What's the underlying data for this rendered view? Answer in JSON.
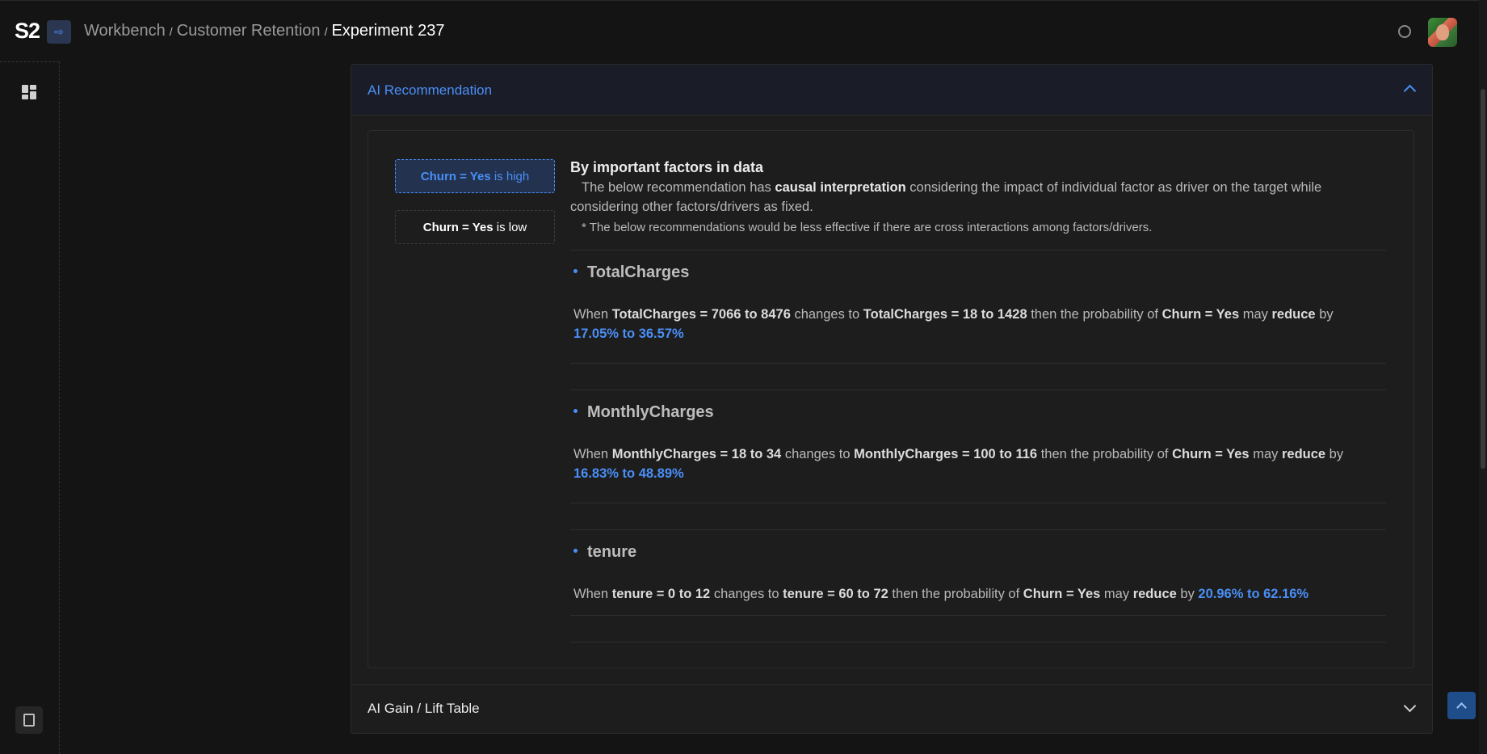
{
  "header": {
    "logo": "S2",
    "breadcrumb": [
      "Workbench",
      "Customer Retention",
      "Experiment 237"
    ],
    "separator": "/"
  },
  "accordion": {
    "ai_recommendation": "AI Recommendation",
    "gain_lift": "AI Gain / Lift Table"
  },
  "options": [
    {
      "target": "Churn = Yes",
      "suffix": "is high"
    },
    {
      "target": "Churn = Yes",
      "suffix": "is low"
    }
  ],
  "intro": {
    "title": "By important factors in data",
    "desc_pre": "The below recommendation has ",
    "desc_bold": "causal interpretation",
    "desc_post": " considering the impact of individual factor as driver on the target while considering other factors/drivers as fixed.",
    "note": "* The below recommendations would be less effective if there are cross interactions among factors/drivers."
  },
  "recommendations": [
    {
      "factor": "TotalCharges",
      "when": "When",
      "from": "TotalCharges = 7066 to 8476",
      "changes_to": "changes to",
      "to": "TotalCharges = 18 to 1428",
      "then": "then the probability of",
      "target": "Churn = Yes",
      "may": "may",
      "direction": "reduce",
      "by": "by",
      "range": "17.05% to 36.57%"
    },
    {
      "factor": "MonthlyCharges",
      "when": "When",
      "from": "MonthlyCharges = 18 to 34",
      "changes_to": "changes to",
      "to": "MonthlyCharges = 100 to 116",
      "then": "then the probability of",
      "target": "Churn = Yes",
      "may": "may",
      "direction": "reduce",
      "by": "by",
      "range": "16.83% to 48.89%"
    },
    {
      "factor": "tenure",
      "when": "When",
      "from": "tenure = 0 to 12",
      "changes_to": "changes to",
      "to": "tenure = 60 to 72",
      "then": "then the probability of",
      "target": "Churn = Yes",
      "may": "may",
      "direction": "reduce",
      "by": "by",
      "range": "20.96% to 62.16%"
    }
  ],
  "colors": {
    "accent": "#4a8ff7",
    "background": "#141414",
    "panel": "#1d1d1d"
  }
}
